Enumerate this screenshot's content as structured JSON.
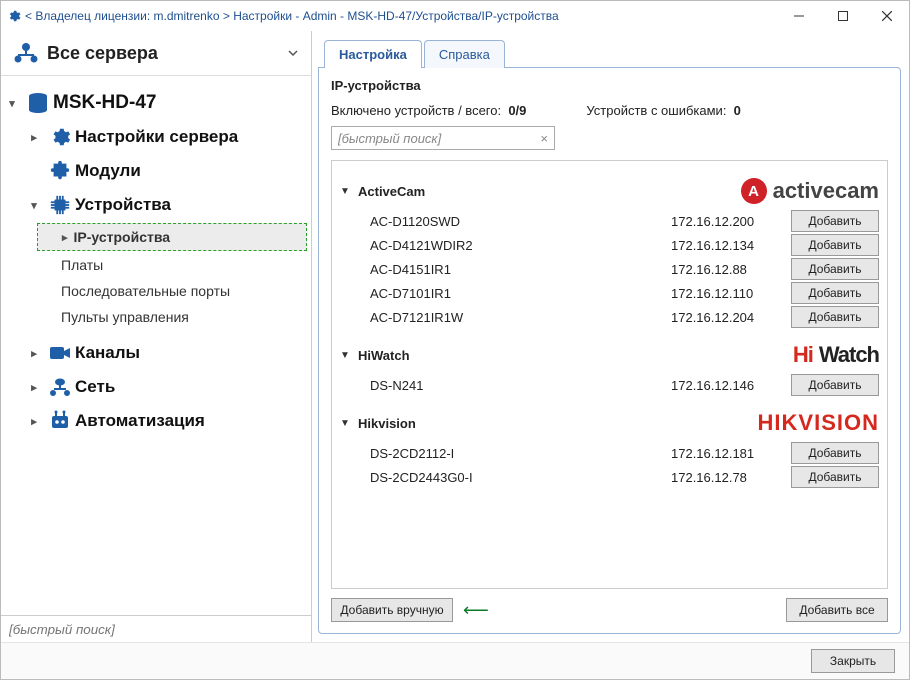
{
  "titlebar": "< Владелец лицензии: m.dmitrenko > Настройки - Admin - MSK-HD-47/Устройства/IP-устройства",
  "sidebar": {
    "all_servers": "Все сервера",
    "server_name": "MSK-HD-47",
    "items": {
      "server_settings": "Настройки сервера",
      "modules": "Модули",
      "devices": "Устройства",
      "channels": "Каналы",
      "network": "Сеть",
      "automation": "Автоматизация"
    },
    "device_children": {
      "ip_devices": "IP-устройства",
      "boards": "Платы",
      "serial_ports": "Последовательные порты",
      "control_panels": "Пульты управления"
    },
    "search_placeholder": "[быстрый поиск]"
  },
  "tabs": {
    "settings": "Настройка",
    "help": "Справка"
  },
  "pane": {
    "title": "IP-устройства",
    "enabled_label": "Включено устройств / всего:",
    "enabled_value": "0/9",
    "errors_label": "Устройств с ошибками:",
    "errors_value": "0",
    "quick_placeholder": "[быстрый поиск]",
    "add_label": "Добавить",
    "add_manual": "Добавить вручную",
    "add_all": "Добавить все"
  },
  "groups": [
    {
      "name": "ActiveCam",
      "brand_style": "activecam",
      "brand_text": "activecam",
      "devices": [
        {
          "model": "AC-D1120SWD",
          "ip": "172.16.12.200"
        },
        {
          "model": "AC-D4121WDIR2",
          "ip": "172.16.12.134"
        },
        {
          "model": "AC-D4151IR1",
          "ip": "172.16.12.88"
        },
        {
          "model": "AC-D7101IR1",
          "ip": "172.16.12.110"
        },
        {
          "model": "AC-D7121IR1W",
          "ip": "172.16.12.204"
        }
      ]
    },
    {
      "name": "HiWatch",
      "brand_style": "hiwatch",
      "brand_text": "HiWatch",
      "devices": [
        {
          "model": "DS-N241",
          "ip": "172.16.12.146"
        }
      ]
    },
    {
      "name": "Hikvision",
      "brand_style": "hikvision",
      "brand_text": "HIKVISION",
      "devices": [
        {
          "model": "DS-2CD2112-I",
          "ip": "172.16.12.181"
        },
        {
          "model": "DS-2CD2443G0-I",
          "ip": "172.16.12.78"
        }
      ]
    }
  ],
  "footer": {
    "close": "Закрыть"
  }
}
